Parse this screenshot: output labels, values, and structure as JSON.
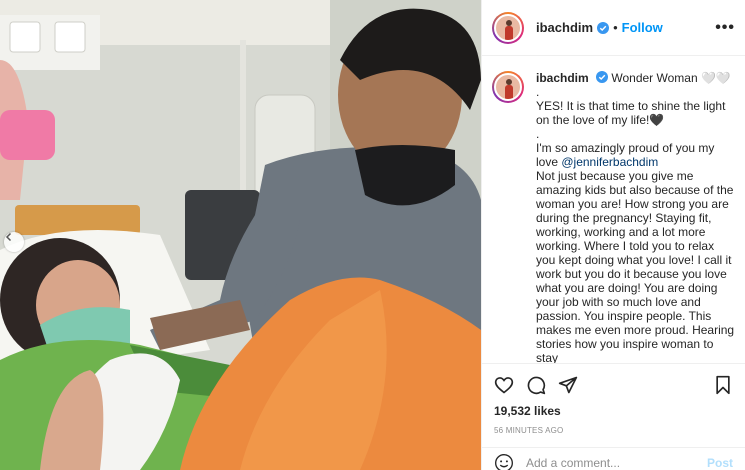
{
  "post": {
    "photo_alt": "Photo"
  },
  "header": {
    "username": "ibachdim",
    "separator": "•",
    "follow_label": "Follow",
    "more_label": "•••"
  },
  "caption": {
    "username": "ibachdim",
    "title": "Wonder Woman 🤍🤍",
    "lines": [
      ".",
      "YES! It is that time to shine the light on the love of my life!🖤",
      ".",
      "I'm so amazingly proud of you my love",
      "Not just because you give me amazing kids but also because of the woman you are! How strong you are during the pregnancy! Staying fit, working, working and a lot more working. Where I told you to relax you kept doing what you love! I call it work but you do it because you love what you are doing! You are doing your job with so much love and passion. You inspire people. This makes me even more proud. Hearing stories how you inspire woman to stay"
    ],
    "mention": "@jenniferbachdim"
  },
  "actions": {
    "like_icon": "heart-icon",
    "comment_icon": "comment-icon",
    "share_icon": "share-icon",
    "save_icon": "bookmark-icon"
  },
  "likes": "19,532 likes",
  "time_ago": "56 MINUTES AGO",
  "comment": {
    "placeholder": "Add a comment...",
    "post_label": "Post"
  },
  "colors": {
    "accent": "#0095f6",
    "verified": "#3897f0",
    "post_disabled": "#b2dffc"
  }
}
